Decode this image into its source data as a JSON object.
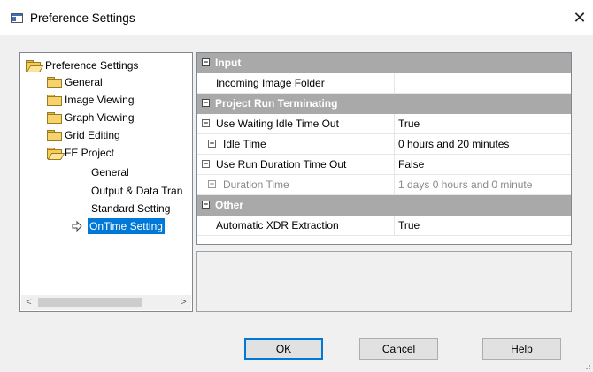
{
  "window": {
    "title": "Preference Settings",
    "close_glyph": "✕"
  },
  "tree": {
    "root": "Preference Settings",
    "items": [
      {
        "label": "General"
      },
      {
        "label": "Image Viewing"
      },
      {
        "label": "Graph Viewing"
      },
      {
        "label": "Grid Editing"
      },
      {
        "label": "FE Project"
      }
    ],
    "fe_children": [
      {
        "label": "General"
      },
      {
        "label": "Output & Data Tran"
      },
      {
        "label": "Standard Setting"
      },
      {
        "label": "OnTime Setting"
      }
    ],
    "selected": "OnTime Setting",
    "scroll_left": "<",
    "scroll_right": ">"
  },
  "grid": {
    "input_category": "Input",
    "incoming_folder": {
      "name": "Incoming Image Folder",
      "value": ""
    },
    "run_category": "Project Run Terminating",
    "waiting_idle": {
      "name": "Use Waiting Idle Time Out",
      "value": "True"
    },
    "idle_time": {
      "name": "Idle Time",
      "value": "0 hours and 20 minutes"
    },
    "run_duration": {
      "name": "Use Run Duration Time Out",
      "value": "False"
    },
    "duration_time": {
      "name": "Duration Time",
      "value": "1 days 0 hours and 0 minute"
    },
    "other_category": "Other",
    "xdr": {
      "name": "Automatic XDR Extraction",
      "value": "True"
    },
    "expand_collapse": "−",
    "expand_plus": "+"
  },
  "buttons": {
    "ok": "OK",
    "cancel": "Cancel",
    "help": "Help"
  },
  "colors": {
    "selection": "#0078d7",
    "category_bg": "#a9a9a9"
  }
}
